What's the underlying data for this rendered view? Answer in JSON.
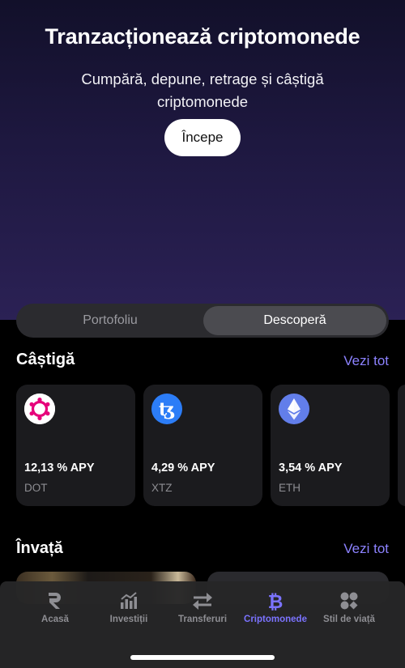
{
  "hero": {
    "title": "Tranzacționează criptomonede",
    "subtitle": "Cumpără, depune, retrage și câștigă criptomonede",
    "cta": "Începe"
  },
  "segment": {
    "tabs": [
      "Portofoliu",
      "Descoperă"
    ],
    "selected": "Descoperă"
  },
  "earn": {
    "title": "Câștigă",
    "see_all": "Vezi tot",
    "cards": [
      {
        "apy": "12,13 % APY",
        "ticker": "DOT",
        "icon": "polkadot-icon",
        "color": "#e6007a"
      },
      {
        "apy": "4,29 % APY",
        "ticker": "XTZ",
        "icon": "tezos-icon",
        "color": "#2c7df7"
      },
      {
        "apy": "3,54 % APY",
        "ticker": "ETH",
        "icon": "ethereum-icon",
        "color": "#627eea"
      }
    ]
  },
  "learn": {
    "title": "Învață",
    "see_all": "Vezi tot"
  },
  "tabbar": {
    "items": [
      {
        "label": "Acasă",
        "icon": "revolut-r-icon"
      },
      {
        "label": "Investiții",
        "icon": "bar-chart-icon"
      },
      {
        "label": "Transferuri",
        "icon": "transfer-arrows-icon"
      },
      {
        "label": "Criptomonede",
        "icon": "bitcoin-icon"
      },
      {
        "label": "Stil de viață",
        "icon": "lifestyle-icon"
      }
    ],
    "active": "Criptomonede",
    "active_color": "#7b73ff"
  }
}
